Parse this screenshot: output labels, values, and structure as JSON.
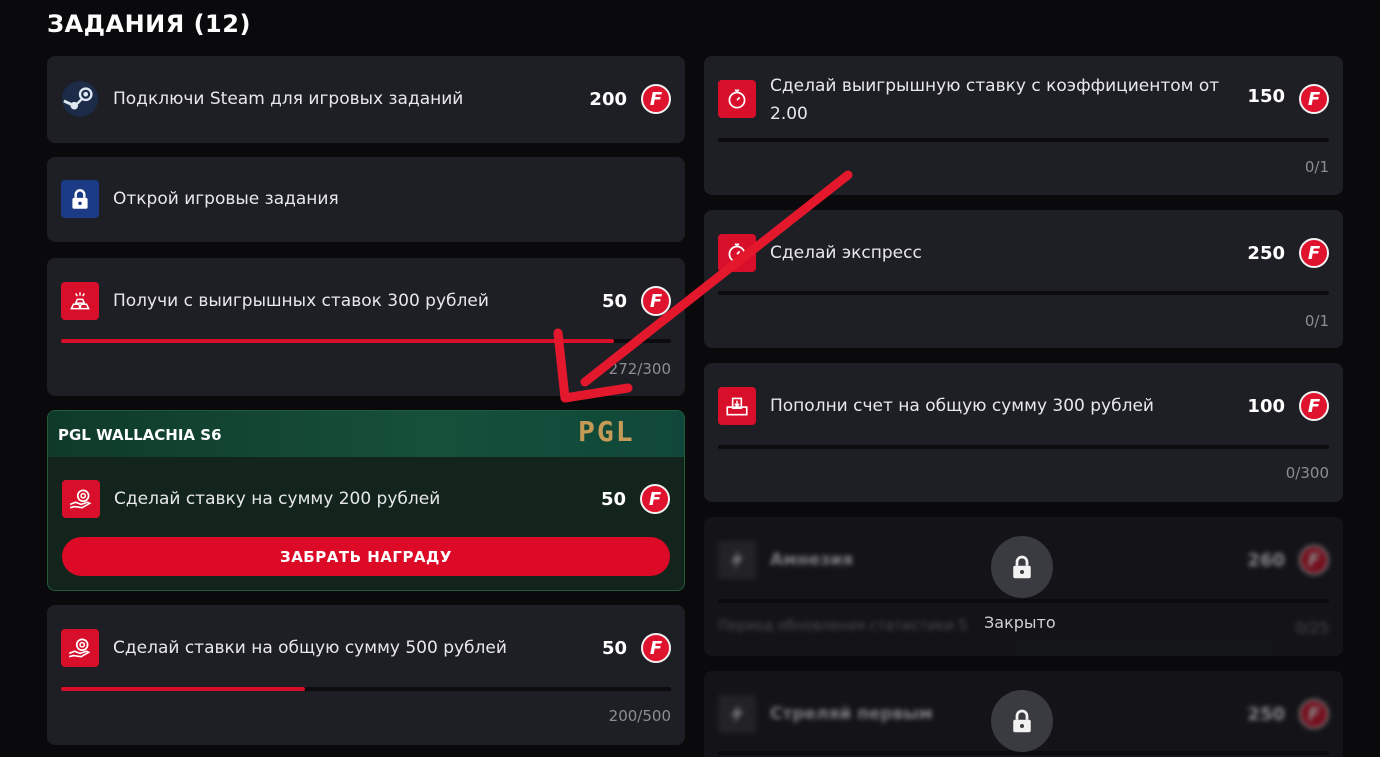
{
  "header": {
    "title": "ЗАДАНИЯ (12)"
  },
  "coin": {
    "glyph": "F",
    "color": "#e0132f"
  },
  "left": {
    "steam": {
      "label": "Подключи Steam для игровых заданий",
      "points": "200",
      "icon": "steam-icon"
    },
    "open_game": {
      "label": "Открой игровые задания",
      "icon": "lock-icon"
    },
    "winnings": {
      "label": "Получи с выигрышных ставок 300 рублей",
      "points": "50",
      "progress": "272/300",
      "fraction": 0.907,
      "icon": "gold-bars-icon"
    },
    "pgl": {
      "event": "PGL WALLACHIA S6",
      "logo": "PGL",
      "label": "Сделай ставку на сумму 200 рублей",
      "points": "50",
      "claim_label": "ЗАБРАТЬ НАГРАДУ",
      "icon": "hand-chip-icon"
    },
    "bets_total": {
      "label": "Сделай ставки на общую сумму 500 рублей",
      "points": "50",
      "progress": "200/500",
      "fraction": 0.4,
      "icon": "hand-chip-icon"
    }
  },
  "right": {
    "win_coef": {
      "label": "Сделай выигрышную ставку с коэффициентом от 2.00",
      "points": "150",
      "progress": "0/1",
      "fraction": 0,
      "icon": "stopwatch-icon"
    },
    "express": {
      "label": "Сделай экспресс",
      "points": "250",
      "progress": "0/1",
      "fraction": 0,
      "icon": "stopwatch-icon"
    },
    "deposit": {
      "label": "Пополни счет на общую сумму 300 рублей",
      "points": "100",
      "progress": "0/300",
      "fraction": 0,
      "icon": "deposit-icon"
    },
    "amnesia": {
      "label": "Амнезия",
      "points": "260",
      "note": "Период обновления статистики 5",
      "progress": "0/25",
      "closed_label": "Закрыто"
    },
    "first_shot": {
      "label": "Стреляй первым",
      "points": "250"
    }
  },
  "colors": {
    "accent": "#d80f2b",
    "card": "#1e1f25",
    "background": "#0a0a0c"
  }
}
